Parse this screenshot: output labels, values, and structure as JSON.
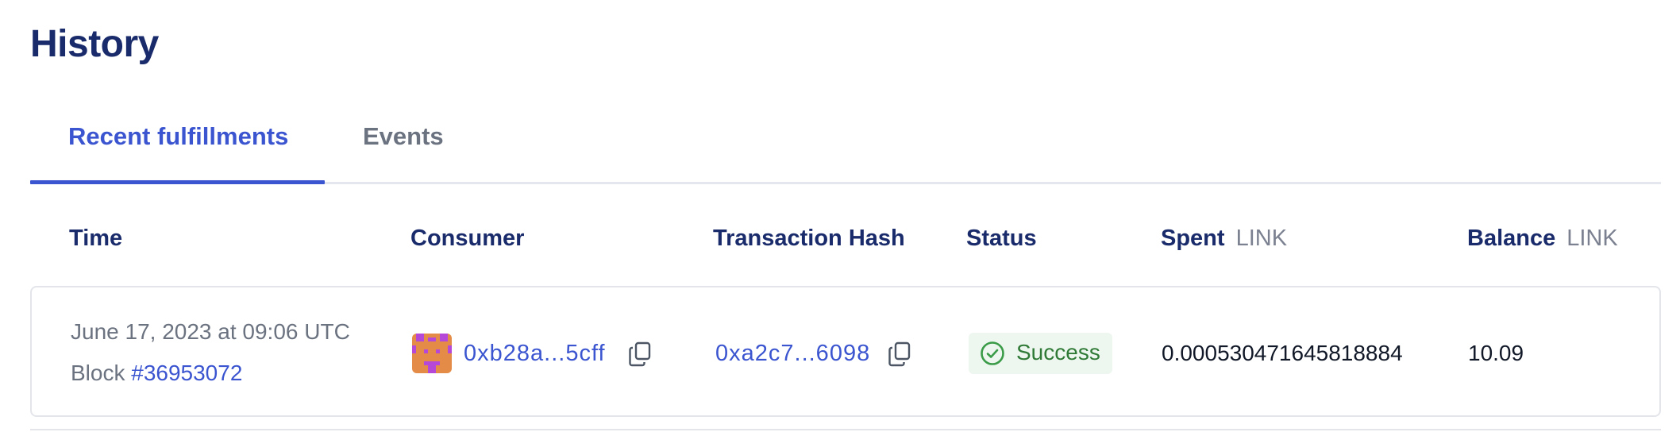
{
  "page": {
    "title": "History"
  },
  "tabs": [
    {
      "label": "Recent fulfillments",
      "active": true
    },
    {
      "label": "Events",
      "active": false
    }
  ],
  "table": {
    "columns": {
      "time": "Time",
      "consumer": "Consumer",
      "tx_hash": "Transaction Hash",
      "status": "Status",
      "spent": {
        "label": "Spent",
        "unit": "LINK"
      },
      "balance": {
        "label": "Balance",
        "unit": "LINK"
      }
    },
    "rows": [
      {
        "time": "June 17, 2023 at 09:06 UTC",
        "block_prefix": "Block",
        "block_number": "#36953072",
        "consumer_address": "0xb28a...5cff",
        "tx_hash": "0xa2c7...6098",
        "status": "Success",
        "spent": "0.000530471645818884",
        "balance": "10.09"
      }
    ]
  },
  "icons": {
    "copy": "copy-icon",
    "status": "check-circle-icon",
    "avatar": "identicon-avatar"
  },
  "colors": {
    "accent": "#3b55d0",
    "heading": "#1a2b6b",
    "muted": "#6b7280",
    "success_bg": "#eef7ef",
    "success_fg": "#2f7a36"
  }
}
